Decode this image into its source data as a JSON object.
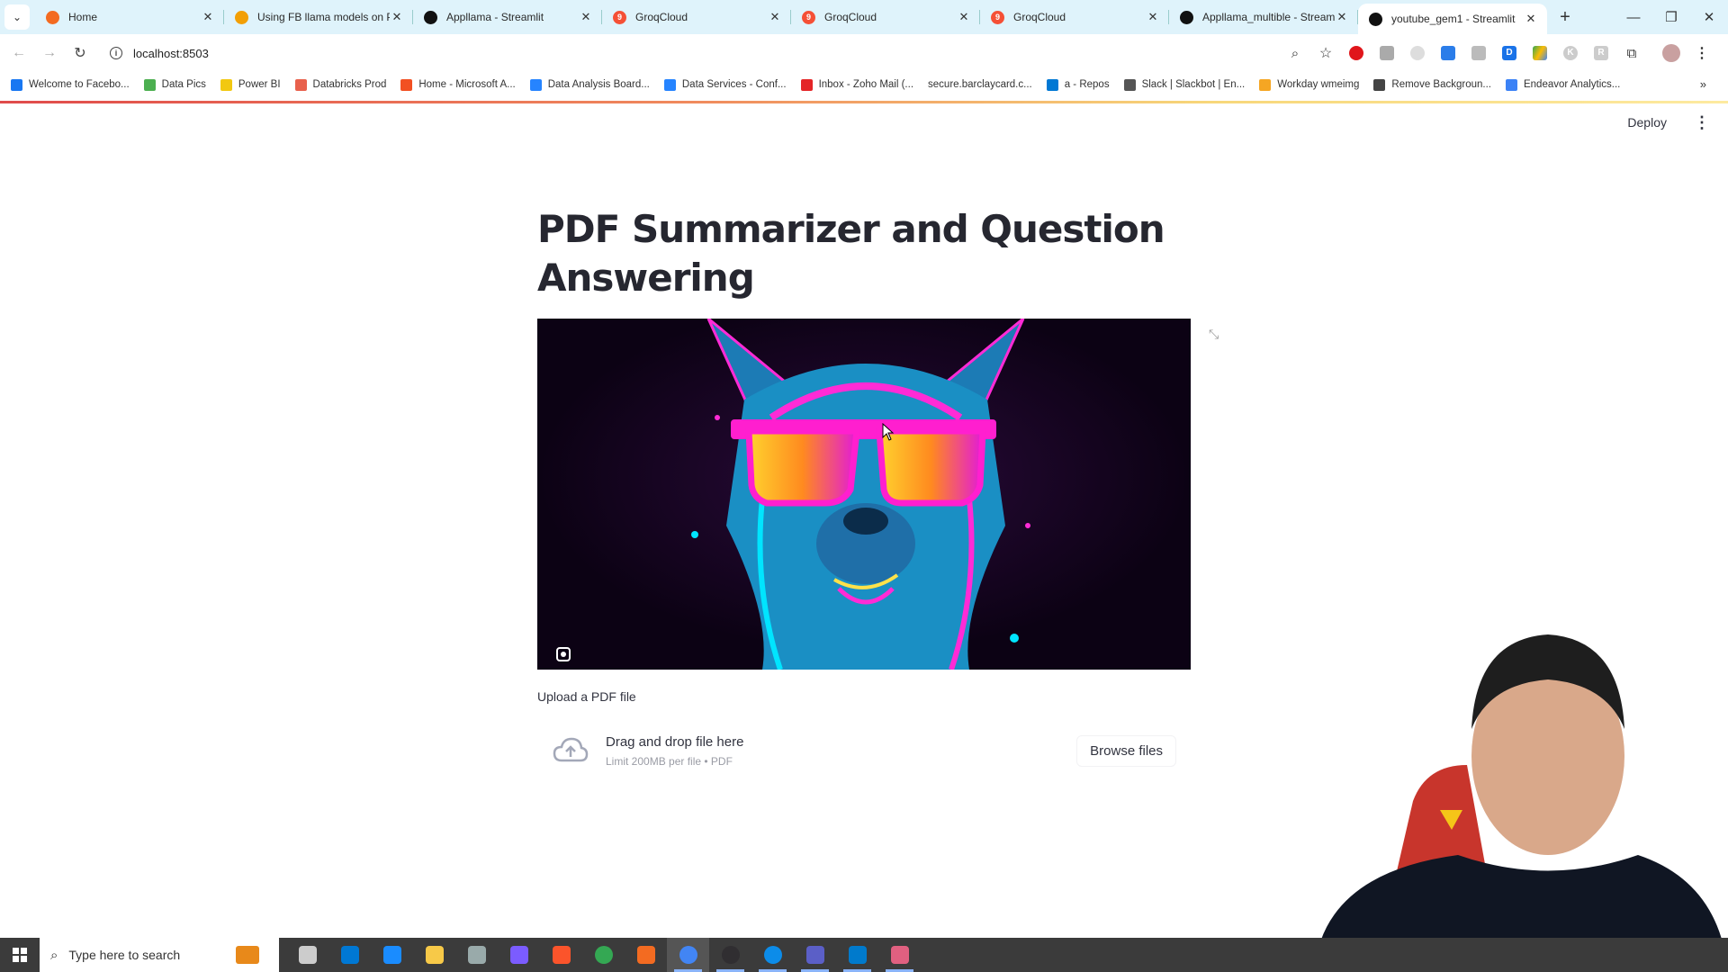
{
  "browser": {
    "tabs": [
      {
        "title": "Home",
        "favicon": "orange-ring-icon",
        "active": false
      },
      {
        "title": "Using FB llama models on PD",
        "favicon": "orange-doc-icon",
        "active": false
      },
      {
        "title": "Appllama - Streamlit",
        "favicon": "streamlit-crown-icon",
        "active": false
      },
      {
        "title": "GroqCloud",
        "favicon": "groq-icon",
        "active": false
      },
      {
        "title": "GroqCloud",
        "favicon": "groq-icon",
        "active": false
      },
      {
        "title": "GroqCloud",
        "favicon": "groq-icon",
        "active": false
      },
      {
        "title": "Appllama_multible - Streamlit",
        "favicon": "streamlit-crown-icon",
        "active": false
      },
      {
        "title": "youtube_gem1 - Streamlit",
        "favicon": "streamlit-crown-icon",
        "active": true
      }
    ],
    "close_glyph": "✕",
    "new_tab_glyph": "+",
    "url": "localhost:8503",
    "bookmarks": [
      {
        "label": "Welcome to Facebo...",
        "color": "#1877f2"
      },
      {
        "label": "Data Pics",
        "color": "#4caf50"
      },
      {
        "label": "Power BI",
        "color": "#f2c811"
      },
      {
        "label": "Databricks Prod",
        "color": "#e8604c"
      },
      {
        "label": "Home - Microsoft A...",
        "color": "#f25022"
      },
      {
        "label": "Data Analysis Board...",
        "color": "#2684ff"
      },
      {
        "label": "Data Services - Conf...",
        "color": "#2684ff"
      },
      {
        "label": "Inbox - Zoho Mail (...",
        "color": "#e42527"
      },
      {
        "label": "secure.barclaycard.c...",
        "color": ""
      },
      {
        "label": "a - Repos",
        "color": "#0078d4"
      },
      {
        "label": "Slack | Slackbot | En...",
        "color": "#555555"
      },
      {
        "label": "Workday wmeimg",
        "color": "#f5a623"
      },
      {
        "label": "Remove Backgroun...",
        "color": "#444444"
      },
      {
        "label": "Endeavor Analytics...",
        "color": "#3b82f6"
      }
    ],
    "bookmarks_more": "»"
  },
  "streamlit": {
    "deploy_label": "Deploy",
    "menu_glyph": "⋮",
    "title": "PDF Summarizer and Question Answering",
    "image_alt": "Neon llama wearing pink sunglasses",
    "uploader": {
      "label": "Upload a PDF file",
      "drag_text": "Drag and drop file here",
      "limit_text": "Limit 200MB per file • PDF",
      "browse_label": "Browse files"
    }
  },
  "taskbar": {
    "search_placeholder": "Type here to search",
    "apps": [
      "task-view",
      "microsoft-store",
      "mail",
      "file-explorer",
      "app",
      "copilot",
      "brave",
      "chrome",
      "app-orange",
      "chrome-active",
      "obs",
      "edge",
      "teams",
      "vscode",
      "snipping-tool"
    ]
  }
}
